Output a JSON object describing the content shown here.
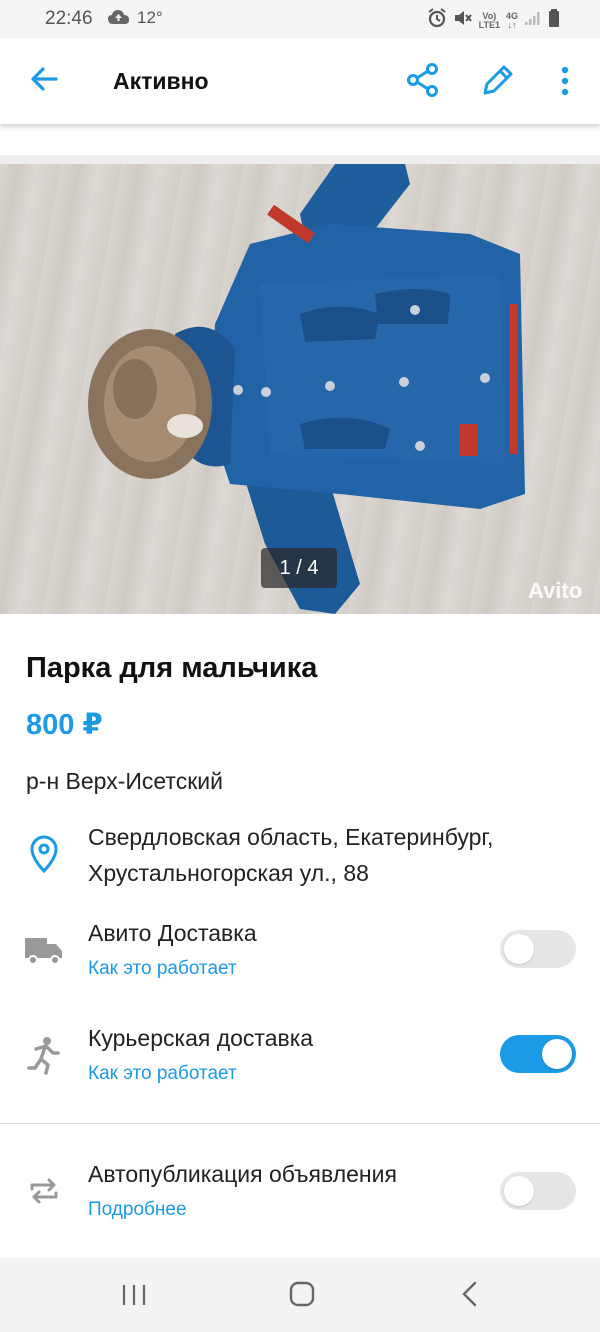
{
  "status_bar": {
    "time": "22:46",
    "temperature": "12°",
    "cloud_icon": "cloud-upload-icon",
    "volte_top": "Vo)",
    "volte_bottom": "LTE1",
    "network_top": "4G",
    "network_bottom": "↓↑"
  },
  "app_bar": {
    "title": "Активно",
    "back_icon": "arrow-left-icon",
    "share_icon": "share-icon",
    "edit_icon": "pencil-icon",
    "more_icon": "more-vertical-icon"
  },
  "photo": {
    "counter": "1 / 4",
    "watermark": "Avito"
  },
  "listing": {
    "title": "Парка для мальчика",
    "price": "800 ₽",
    "district": "р-н Верх-Исетский",
    "address": "Свердловская область, Екатеринбург, Хрустальногорская ул., 88"
  },
  "delivery": {
    "avito": {
      "label": "Авито Доставка",
      "link": "Как это работает",
      "enabled": false,
      "icon": "truck-icon"
    },
    "courier": {
      "label": "Курьерская доставка",
      "link": "Как это работает",
      "enabled": true,
      "icon": "running-person-icon"
    }
  },
  "autopublish": {
    "label": "Автопубликация объявления",
    "link": "Подробнее",
    "enabled": false,
    "icon": "repeat-icon"
  },
  "colors": {
    "accent": "#1b9ae6",
    "toggle_off": "#e6e6e6"
  },
  "nav_bar": {
    "recents_icon": "recents-icon",
    "home_icon": "home-icon",
    "back_icon": "back-chevron-icon"
  }
}
